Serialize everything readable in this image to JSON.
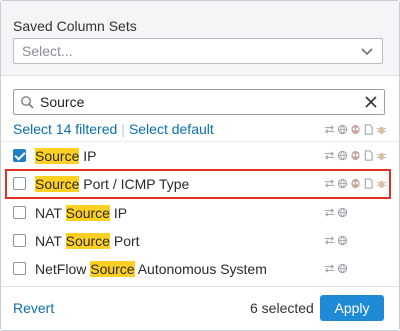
{
  "saved_column_sets": {
    "label": "Saved Column Sets",
    "placeholder": "Select..."
  },
  "search": {
    "value": "Source"
  },
  "links": {
    "select_filtered": "Select 14 filtered",
    "select_default": "Select default"
  },
  "rows": [
    {
      "prefix": "",
      "match": "Source",
      "suffix": " IP",
      "checked": true,
      "icons": [
        "arrows-icon",
        "globe-icon",
        "alien-icon",
        "document-icon",
        "bug-icon"
      ]
    },
    {
      "prefix": "",
      "match": "Source",
      "suffix": " Port / ICMP Type",
      "checked": false,
      "icons": [
        "arrows-icon",
        "globe-icon",
        "alien-icon",
        "document-icon",
        "bug-icon"
      ]
    },
    {
      "prefix": "NAT ",
      "match": "Source",
      "suffix": " IP",
      "checked": false,
      "icons": [
        "arrows-icon",
        "globe-icon"
      ]
    },
    {
      "prefix": "NAT ",
      "match": "Source",
      "suffix": " Port",
      "checked": false,
      "icons": [
        "arrows-icon",
        "globe-icon"
      ]
    },
    {
      "prefix": "NetFlow ",
      "match": "Source",
      "suffix": " Autonomous System",
      "checked": false,
      "icons": [
        "arrows-icon",
        "globe-icon"
      ]
    }
  ],
  "footer": {
    "revert": "Revert",
    "selected_count": "6 selected",
    "apply": "Apply"
  },
  "colors": {
    "accent": "#1f8bd6",
    "link": "#0a6fae",
    "highlight": "#ffd024",
    "annotation": "#e0311f"
  }
}
